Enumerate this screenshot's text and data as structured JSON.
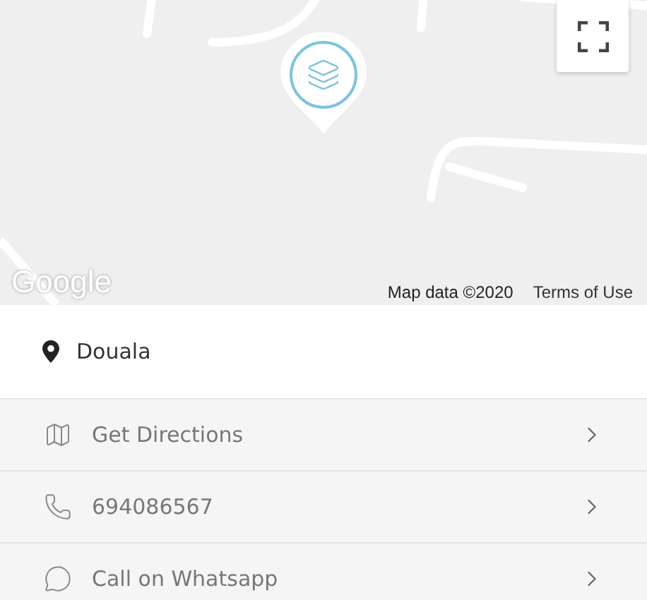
{
  "map": {
    "logo": "Google",
    "attribution": "Map data ©2020",
    "terms_link": "Terms of Use"
  },
  "location": {
    "name": "Douala"
  },
  "actions": [
    {
      "kind": "directions",
      "label": "Get Directions"
    },
    {
      "kind": "phone",
      "label": "694086567"
    },
    {
      "kind": "whatsapp",
      "label": "Call on Whatsapp"
    }
  ]
}
